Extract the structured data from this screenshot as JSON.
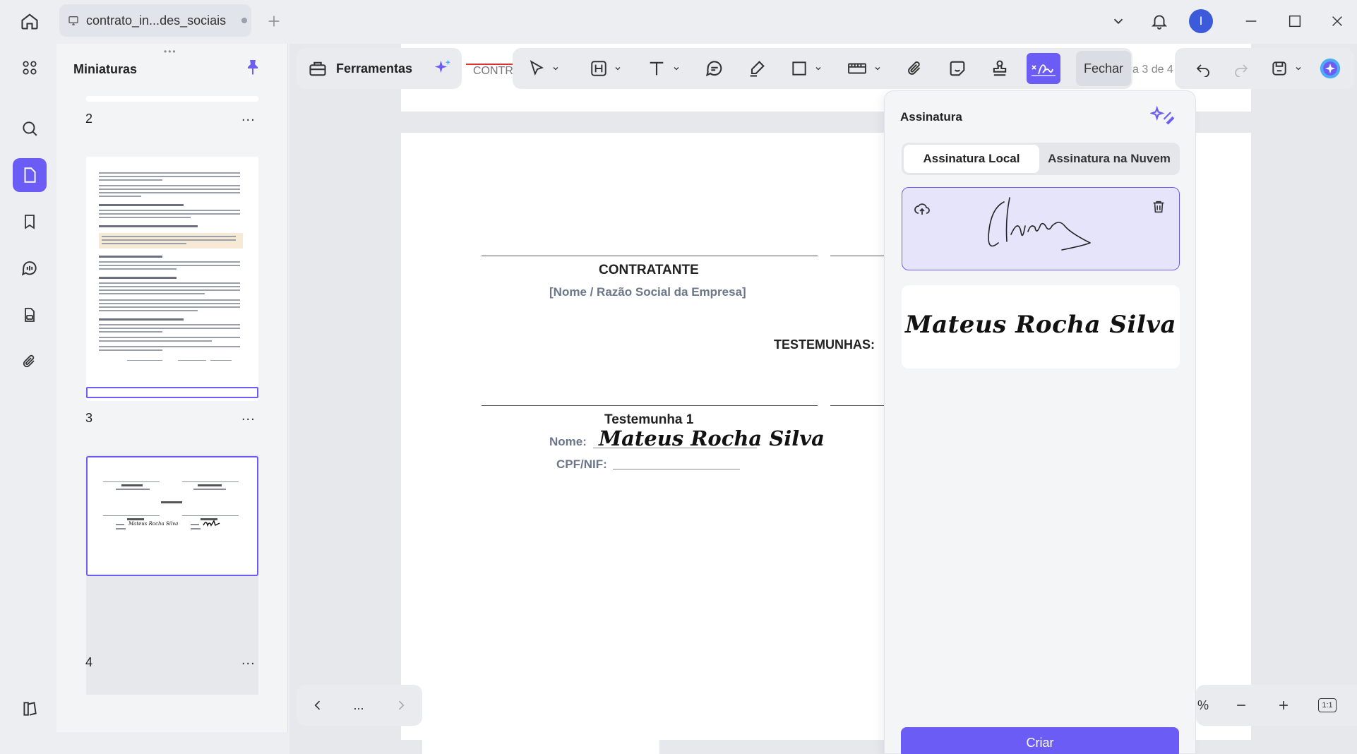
{
  "titlebar": {
    "tab_title": "contrato_in...des_sociais",
    "avatar_initial": "I"
  },
  "thumbnails": {
    "title": "Miniaturas",
    "pages": [
      {
        "number": "2",
        "more": "..."
      },
      {
        "number": "3",
        "more": "..."
      },
      {
        "number": "4",
        "more": "..."
      }
    ]
  },
  "toolbar": {
    "tools_label": "Ferramentas",
    "close_label": "Fechar",
    "page_indicator": "a 3 de 4",
    "behind_text": "CONTR"
  },
  "document": {
    "party_title": "CONTRATANTE",
    "party_subtitle": "[Nome / Razão Social da Empresa]",
    "witnesses_label": "TESTEMUNHAS:",
    "witness1_title": "Testemunha 1",
    "name_label": "Nome:",
    "signed_name": "Mateus Rocha Silva",
    "cpf_label": "CPF/NIF:"
  },
  "signature_panel": {
    "title": "Assinatura",
    "tab_local": "Assinatura Local",
    "tab_cloud": "Assinatura na Nuvem",
    "typed_signature": "Mateus Rocha Silva",
    "create_button": "Criar"
  },
  "pager": {
    "dots": "..."
  },
  "zoom": {
    "percent_suffix": "%",
    "fit_label": "1:1"
  },
  "colors": {
    "accent": "#6c5cf6",
    "background": "#eceef2"
  }
}
